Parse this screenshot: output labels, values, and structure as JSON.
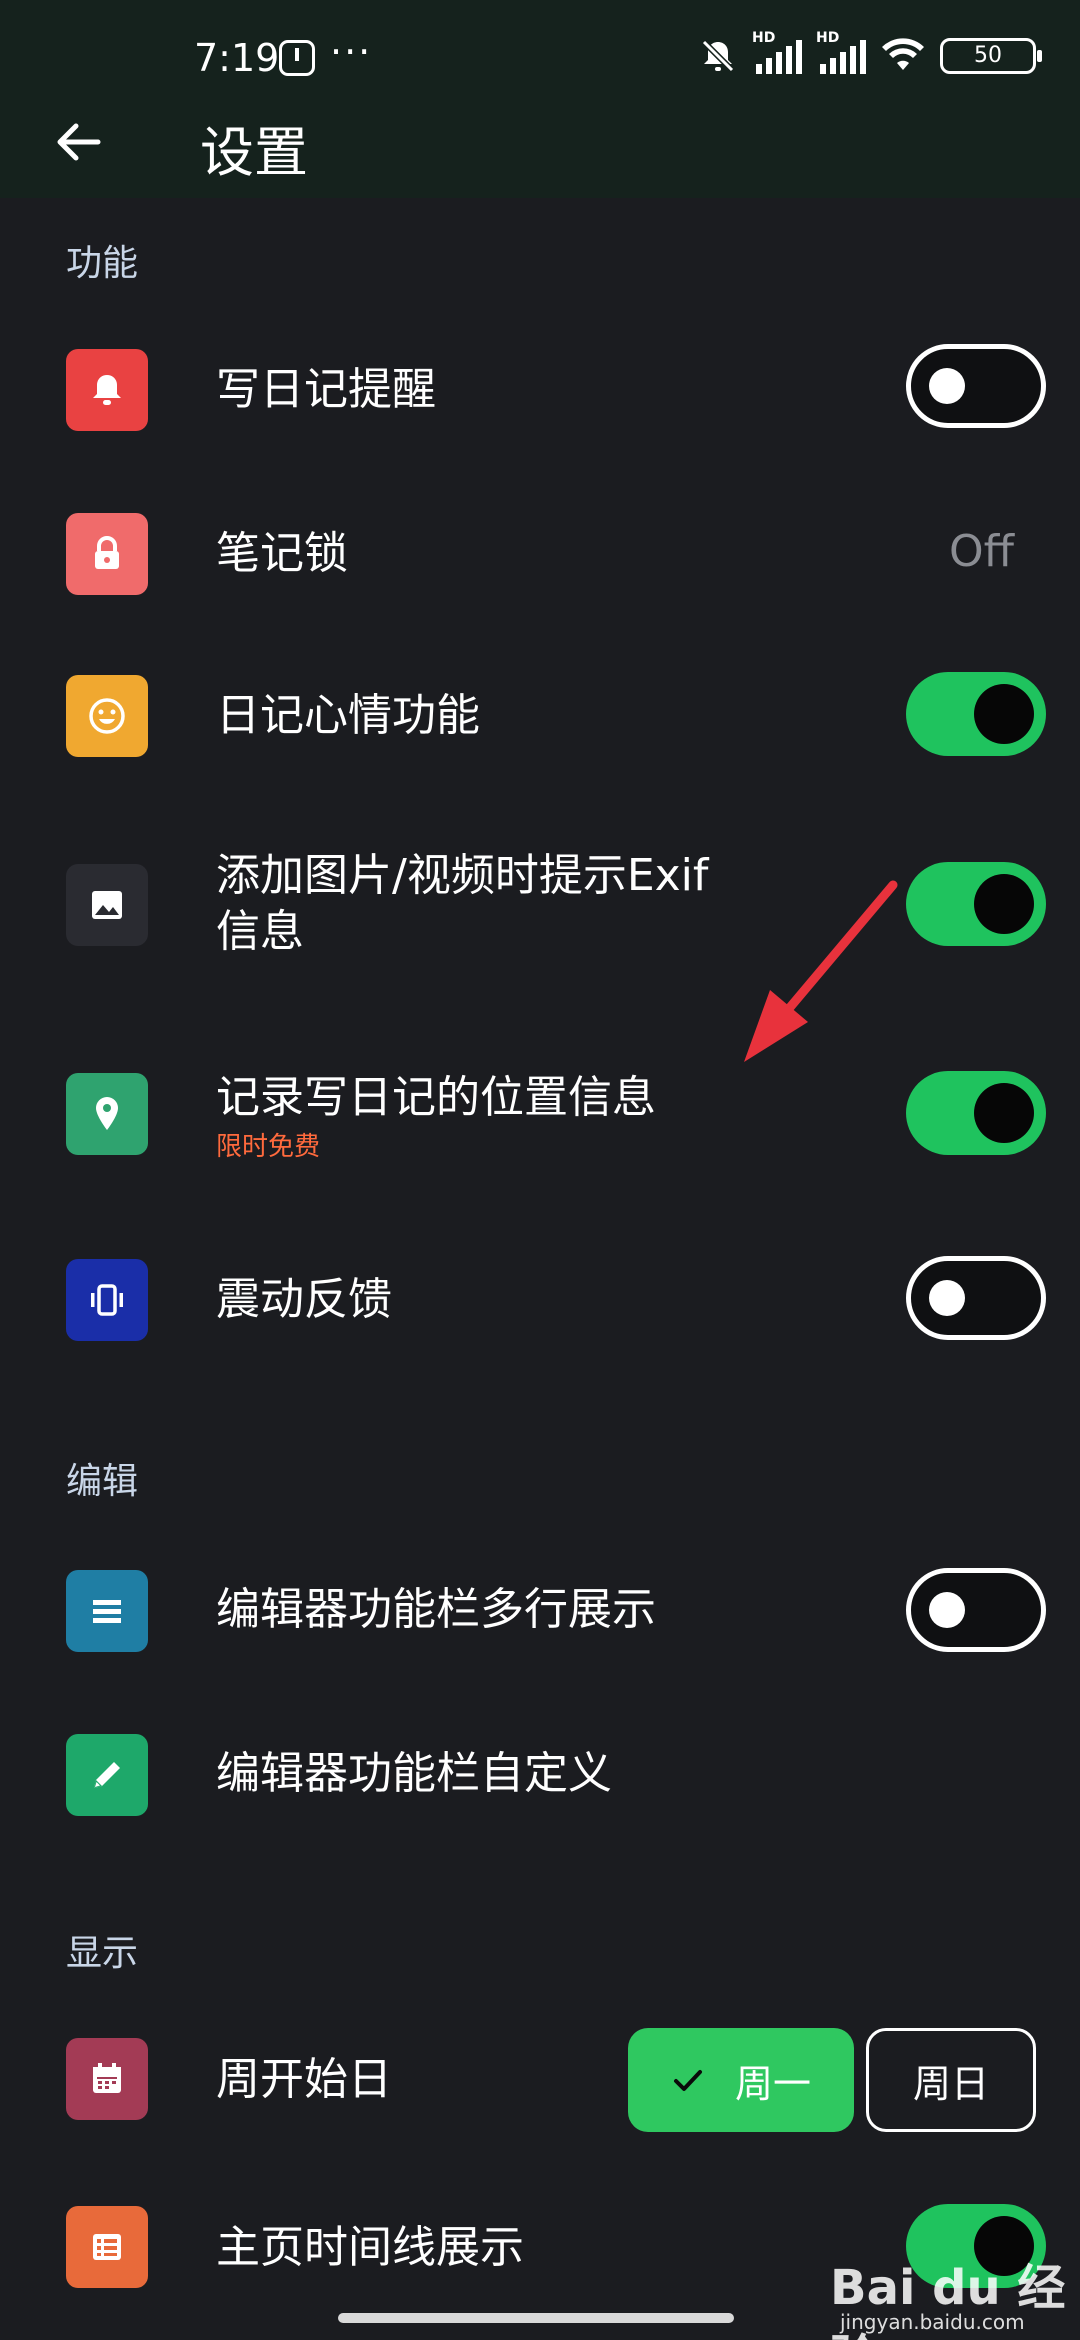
{
  "status_bar": {
    "time": "7:19",
    "more": "···",
    "hd1": "HD",
    "hd2": "HD",
    "battery": "50"
  },
  "header": {
    "title": "设置"
  },
  "sections": {
    "features": "功能",
    "edit": "编辑",
    "display": "显示"
  },
  "rows": {
    "diary_reminder": {
      "label": "写日记提醒",
      "toggle": "off",
      "icon_color": "#e94242",
      "icon": "bell-icon"
    },
    "note_lock": {
      "label": "笔记锁",
      "value": "Off",
      "icon_color": "#f06b6b",
      "icon": "lock-icon"
    },
    "mood": {
      "label": "日记心情功能",
      "toggle": "on",
      "icon_color": "#f0a830",
      "icon": "smiley-icon"
    },
    "exif": {
      "label_line1": "添加图片/视频时提示Exif",
      "label_line2": "信息",
      "toggle": "on",
      "icon_color": "#2a2b31",
      "icon": "image-icon"
    },
    "location": {
      "label": "记录写日记的位置信息",
      "sublabel": "限时免费",
      "toggle": "on",
      "icon_color": "#2fa36f",
      "icon": "location-pin-icon"
    },
    "vibration": {
      "label": "震动反馈",
      "toggle": "off",
      "icon_color": "#1a2ea8",
      "icon": "vibrate-icon"
    },
    "toolbar_multiline": {
      "label": "编辑器功能栏多行展示",
      "toggle": "off",
      "icon_color": "#1f7ea4",
      "icon": "list-icon"
    },
    "toolbar_custom": {
      "label": "编辑器功能栏自定义",
      "icon_color": "#1ea86a",
      "icon": "pencil-icon"
    },
    "week_start": {
      "label": "周开始日",
      "option_selected": "周一",
      "option_other": "周日",
      "icon_color": "#a33b55",
      "icon": "calendar-icon"
    },
    "timeline": {
      "label": "主页时间线展示",
      "toggle": "on",
      "icon_color": "#e86a3a",
      "icon": "table-icon"
    }
  },
  "watermark": {
    "brand": "Bai du 经验",
    "url": "jingyan.baidu.com"
  }
}
